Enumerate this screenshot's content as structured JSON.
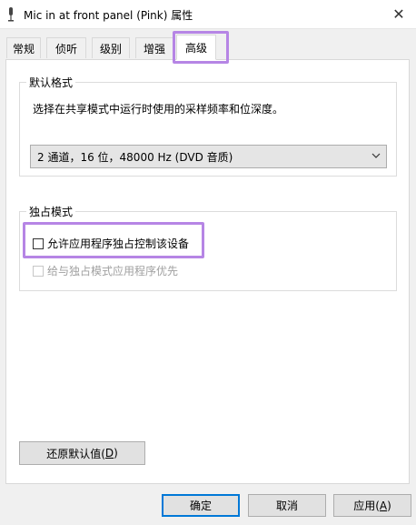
{
  "window": {
    "title": "Mic in at front panel (Pink) 属性",
    "close_glyph": "✕"
  },
  "tabs": [
    {
      "label": "常规"
    },
    {
      "label": "侦听"
    },
    {
      "label": "级别"
    },
    {
      "label": "增强"
    },
    {
      "label": "高级",
      "active": true
    }
  ],
  "default_format": {
    "group_title": "默认格式",
    "description": "选择在共享模式中运行时使用的采样频率和位深度。",
    "selected_value": "2 通道，16 位，48000 Hz (DVD 音质)"
  },
  "exclusive_mode": {
    "group_title": "独占模式",
    "allow_exclusive_label": "允许应用程序独占控制该设备",
    "allow_exclusive_checked": false,
    "give_priority_label": "给与独占模式应用程序优先",
    "give_priority_checked": false,
    "give_priority_enabled": false
  },
  "buttons": {
    "restore_defaults_prefix": "还原默认值(",
    "restore_defaults_key": "D",
    "restore_defaults_suffix": ")",
    "ok": "确定",
    "cancel": "取消",
    "apply_prefix": "应用(",
    "apply_key": "A",
    "apply_suffix": ")"
  },
  "colors": {
    "highlight": "#b685e5",
    "default_button_border": "#0078d7"
  },
  "icons": {
    "window_icon": "microphone-icon",
    "dropdown": "chevron-down-icon"
  }
}
